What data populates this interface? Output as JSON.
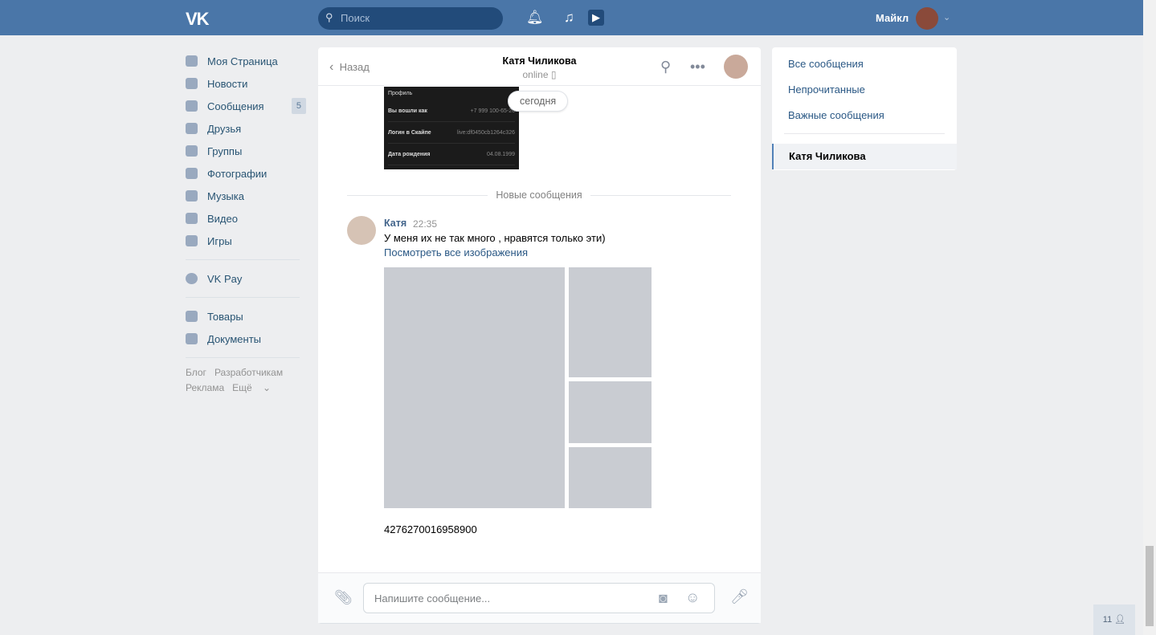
{
  "header": {
    "logo": "VK",
    "search_placeholder": "Поиск",
    "user_name": "Майкл"
  },
  "sidebar": {
    "items": [
      {
        "label": "Моя Страница"
      },
      {
        "label": "Новости"
      },
      {
        "label": "Сообщения",
        "badge": "5"
      },
      {
        "label": "Друзья"
      },
      {
        "label": "Группы"
      },
      {
        "label": "Фотографии"
      },
      {
        "label": "Музыка"
      },
      {
        "label": "Видео"
      },
      {
        "label": "Игры"
      }
    ],
    "vkpay": "VK Pay",
    "goods": "Товары",
    "docs": "Документы",
    "footer": {
      "blog": "Блог",
      "dev": "Разработчикам",
      "ads": "Реклама",
      "more": "Ещё"
    }
  },
  "chat": {
    "back": "Назад",
    "name": "Катя Чиликова",
    "status": "online",
    "screenshot": {
      "title": "Профиль",
      "rows": [
        {
          "k": "Вы вошли как",
          "v": "+7 999 100-65-26"
        },
        {
          "k": "Логин в Скайпе",
          "v": "live:df0450cb1264c326"
        },
        {
          "k": "Дата рождения",
          "v": "04.08.1999"
        }
      ]
    },
    "date_badge": "сегодня",
    "new_messages": "Новые сообщения",
    "message": {
      "author": "Катя",
      "time": "22:35",
      "text": "У меня их не так много , нравятся только эти)",
      "link": "Посмотреть все изображения",
      "number": "4276270016958900"
    },
    "input_placeholder": "Напишите сообщение..."
  },
  "filters": {
    "all": "Все сообщения",
    "unread": "Непрочитанные",
    "important": "Важные сообщения",
    "active": "Катя Чиликова"
  },
  "online_count": "11"
}
